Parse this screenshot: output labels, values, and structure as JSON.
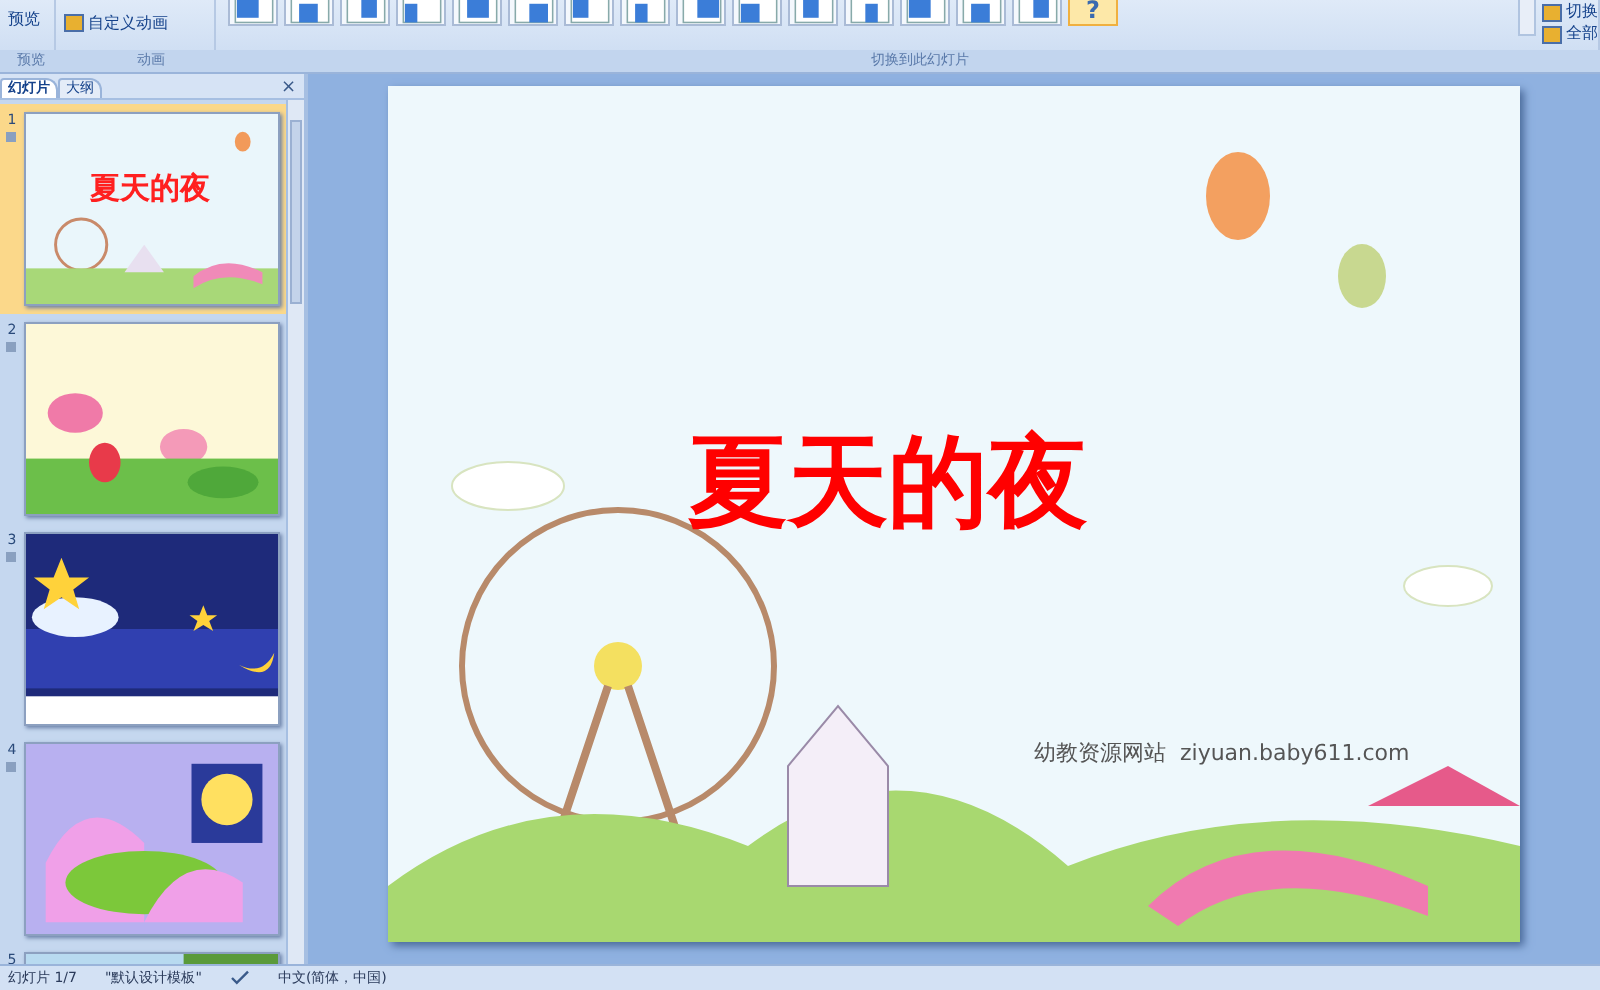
{
  "ribbon": {
    "preview_button": "预览",
    "animation_button": "自定义动画",
    "groups": [
      "预览",
      "动画",
      "切换到此幻灯片"
    ],
    "transitions": [
      {
        "selected": false
      },
      {
        "selected": false
      },
      {
        "selected": false
      },
      {
        "selected": false
      },
      {
        "selected": false
      },
      {
        "selected": false
      },
      {
        "selected": false
      },
      {
        "selected": false
      },
      {
        "selected": false
      },
      {
        "selected": false
      },
      {
        "selected": false
      },
      {
        "selected": false
      },
      {
        "selected": false
      },
      {
        "selected": false
      },
      {
        "selected": false
      },
      {
        "label": "?",
        "selected": true
      }
    ],
    "right_buttons": [
      "切换",
      "全部"
    ]
  },
  "panel": {
    "tabs": [
      {
        "label": "幻灯片",
        "selected": true
      },
      {
        "label": "大纲",
        "selected": false
      }
    ],
    "close": "×",
    "slides": [
      {
        "number": "1",
        "kind": "fairground",
        "title": "夏天的夜",
        "selected": true
      },
      {
        "number": "2",
        "kind": "lotus",
        "selected": false
      },
      {
        "number": "3",
        "kind": "night",
        "selected": false
      },
      {
        "number": "4",
        "kind": "bedroom",
        "selected": false
      },
      {
        "number": "5",
        "kind": "forest",
        "selected": false
      }
    ]
  },
  "slide": {
    "title": "夏天的夜",
    "credit": "幼教资源网站  ziyuan.baby611.com"
  },
  "status_bar": {
    "slide": "幻灯片 1/7",
    "template": "\"默认设计模板\"",
    "language": "中文(简体，中国)"
  }
}
